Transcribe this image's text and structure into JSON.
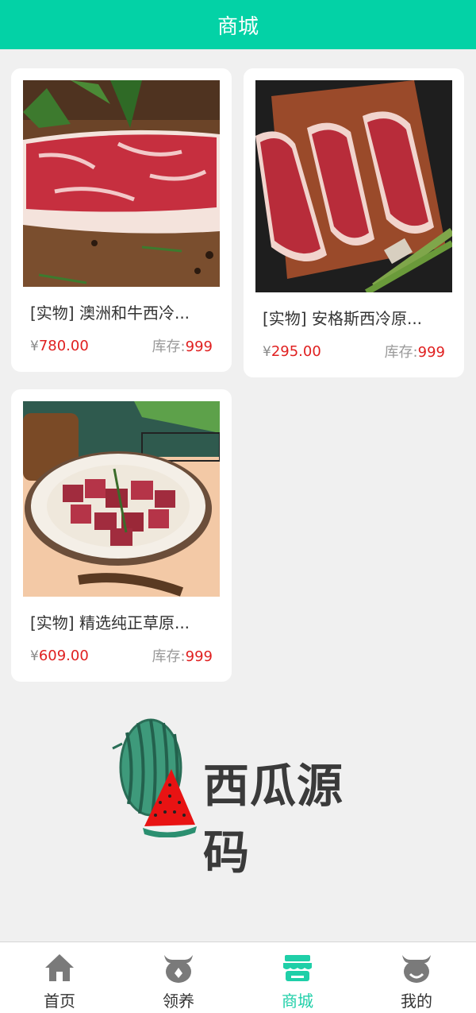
{
  "header": {
    "title": "商城"
  },
  "products": [
    {
      "name": "[实物] 澳洲和牛西冷...",
      "currency": "¥",
      "price": "780.00",
      "stock_label": "库存:",
      "stock": "999"
    },
    {
      "name": "[实物] 安格斯西冷原...",
      "currency": "¥",
      "price": "295.00",
      "stock_label": "库存:",
      "stock": "999"
    },
    {
      "name": "[实物] 精选纯正草原...",
      "currency": "¥",
      "price": "609.00",
      "stock_label": "库存:",
      "stock": "999"
    }
  ],
  "watermark": {
    "text": "西瓜源码"
  },
  "tabbar": {
    "items": [
      {
        "label": "首页",
        "icon": "home-icon",
        "active": false
      },
      {
        "label": "领养",
        "icon": "adopt-cow-icon",
        "active": false
      },
      {
        "label": "商城",
        "icon": "shop-icon",
        "active": true
      },
      {
        "label": "我的",
        "icon": "profile-cow-icon",
        "active": false
      }
    ]
  },
  "colors": {
    "primary": "#03d2a6",
    "price": "#e02020",
    "tab_active": "#1fcfa8",
    "background": "#f0f0f0"
  }
}
